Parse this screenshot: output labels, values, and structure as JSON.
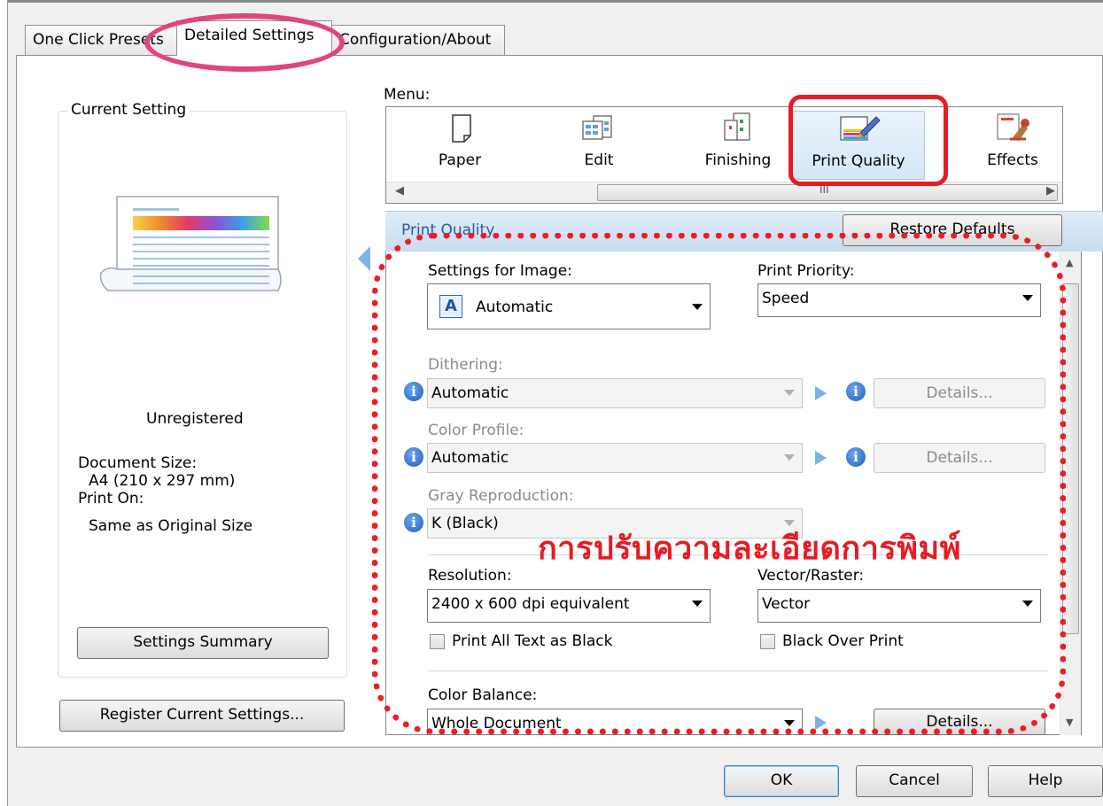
{
  "tabs": [
    {
      "label": "One Click Presets"
    },
    {
      "label": "Detailed Settings"
    },
    {
      "label": "Configuration/About"
    }
  ],
  "current_setting": {
    "title": "Current Setting",
    "registration": "Unregistered",
    "document_size_label": "Document Size:",
    "document_size_value": "A4 (210 x 297 mm)",
    "print_on_label": "Print On:",
    "print_on_value": "Same as Original Size",
    "settings_summary_button": "Settings Summary",
    "register_button": "Register Current Settings..."
  },
  "menu": {
    "label": "Menu:",
    "items": [
      {
        "label": "Paper",
        "icon": "paper-icon"
      },
      {
        "label": "Edit",
        "icon": "edit-icon"
      },
      {
        "label": "Finishing",
        "icon": "finishing-icon"
      },
      {
        "label": "Print Quality",
        "icon": "print-quality-icon",
        "selected": true
      },
      {
        "label": "Effects",
        "icon": "effects-icon"
      }
    ],
    "scroll_grip": "III"
  },
  "print_quality": {
    "title": "Print Quality",
    "restore_button": "Restore Defaults",
    "settings_for_image_label": "Settings for Image:",
    "settings_for_image_value": "Automatic",
    "print_priority_label": "Print Priority:",
    "print_priority_value": "Speed",
    "dithering_label": "Dithering:",
    "dithering_value": "Automatic",
    "color_profile_label": "Color Profile:",
    "color_profile_value": "Automatic",
    "gray_reproduction_label": "Gray Reproduction:",
    "gray_reproduction_value": "K (Black)",
    "details_label": "Details...",
    "resolution_label": "Resolution:",
    "resolution_value": "2400 x 600 dpi equivalent",
    "vector_raster_label": "Vector/Raster:",
    "vector_raster_value": "Vector",
    "print_all_text_black": "Print All Text as Black",
    "black_over_print": "Black Over Print",
    "color_balance_label": "Color Balance:",
    "color_balance_value": "Whole Document"
  },
  "footer": {
    "ok": "OK",
    "cancel": "Cancel",
    "help": "Help"
  },
  "annotation": {
    "thai_text": "การปรับความละเอียดการพิมพ์",
    "color": "#e81b23"
  }
}
